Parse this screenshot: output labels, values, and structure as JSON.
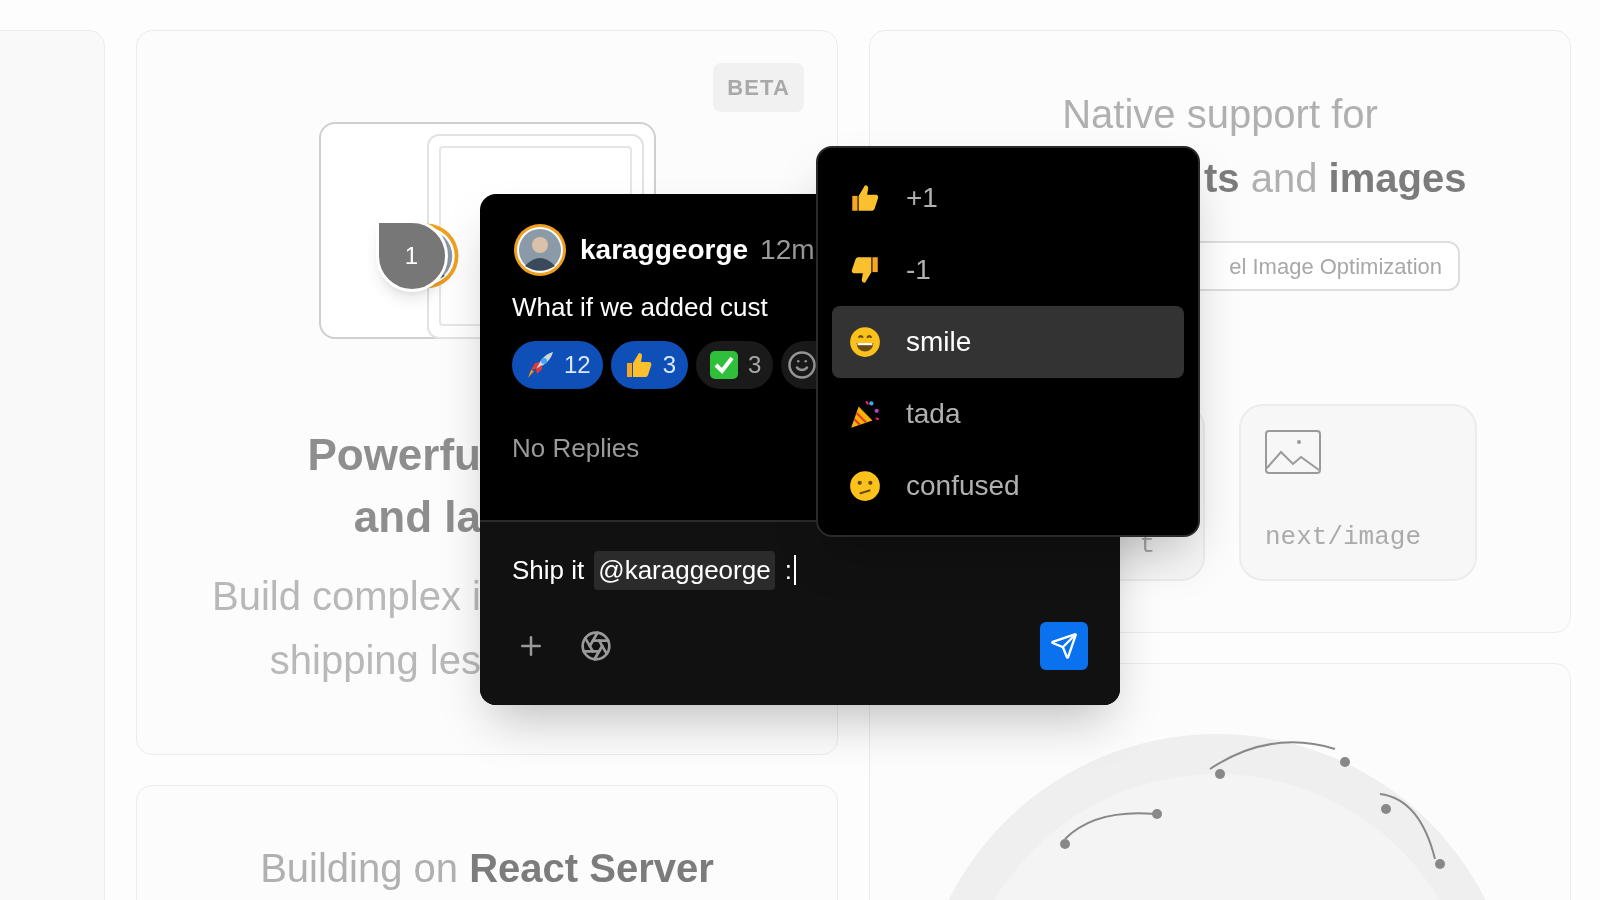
{
  "feature_card": {
    "badge": "BETA",
    "pin_label": "1",
    "title_lines": [
      "Powerfu",
      "and la"
    ],
    "body_lines": [
      "Build complex i",
      "shipping les"
    ]
  },
  "image_card": {
    "heading_lines": [
      "Native support for",
      "**ts** and **images**"
    ],
    "link_button": "el Image Optimization",
    "tiles": [
      {
        "kind": "blank",
        "label": "t"
      },
      {
        "kind": "image",
        "label": "next/image"
      }
    ]
  },
  "rsc_card": {
    "heading": "Building on **React Server**"
  },
  "comment_thread": {
    "author": "karaggeorge",
    "time": "12m",
    "message": "What if we added cust",
    "reactions": [
      {
        "kind": "rocket",
        "count": "12",
        "selected": true
      },
      {
        "kind": "thumbs_up",
        "count": "3",
        "selected": true
      },
      {
        "kind": "check",
        "count": "3",
        "selected": false
      }
    ],
    "replies_label": "No Replies",
    "composer": {
      "text_before": "Ship it",
      "mention": "@karaggeorge",
      "text_after": ":"
    }
  },
  "emoji_menu": {
    "items": [
      {
        "kind": "thumbs_up",
        "label": "+1",
        "selected": false
      },
      {
        "kind": "thumbs_down",
        "label": "-1",
        "selected": false
      },
      {
        "kind": "smile",
        "label": "smile",
        "selected": true
      },
      {
        "kind": "tada",
        "label": "tada",
        "selected": false
      },
      {
        "kind": "confused",
        "label": "confused",
        "selected": false
      }
    ]
  }
}
